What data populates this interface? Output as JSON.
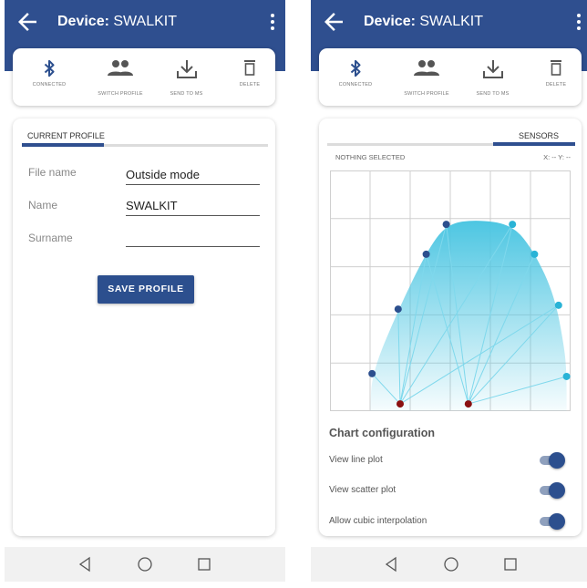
{
  "device": {
    "title_prefix": "Device:",
    "title_name": "SWALKIT"
  },
  "toolbar": {
    "connected_label": "CONNECTED",
    "switch_profile_label": "SWITCH PROFILE",
    "send_label": "SEND TO MS",
    "delete_label": "DELETE"
  },
  "profile": {
    "tab_label": "CURRENT PROFILE",
    "fields": {
      "file_name": {
        "label": "File name",
        "value": "Outside mode"
      },
      "name": {
        "label": "Name",
        "value": "SWALKIT"
      },
      "surname": {
        "label": "Surname",
        "value": ""
      }
    },
    "save_label": "SAVE PROFILE"
  },
  "sensors": {
    "tab_label": "SENSORS",
    "selection": "NOTHING SELECTED",
    "coordinates": "X: -- Y: --"
  },
  "chart_data": {
    "type": "scatter",
    "xlim": [
      0,
      6
    ],
    "ylim": [
      0,
      5
    ],
    "grid": true,
    "points": [
      {
        "x": 1.75,
        "y": 0.15,
        "color": "#8a1010"
      },
      {
        "x": 3.45,
        "y": 0.15,
        "color": "#8a1010"
      },
      {
        "x": 1.05,
        "y": 0.78,
        "color": "#2c4f8e"
      },
      {
        "x": 1.7,
        "y": 2.12,
        "color": "#2c4f8e"
      },
      {
        "x": 2.4,
        "y": 3.26,
        "color": "#2c4f8e"
      },
      {
        "x": 2.9,
        "y": 3.88,
        "color": "#2c4f8e"
      },
      {
        "x": 4.55,
        "y": 3.88,
        "color": "#29b3d6"
      },
      {
        "x": 5.1,
        "y": 3.26,
        "color": "#29b3d6"
      },
      {
        "x": 5.7,
        "y": 2.2,
        "color": "#29b3d6"
      },
      {
        "x": 5.9,
        "y": 0.72,
        "color": "#29b3d6"
      }
    ],
    "outline": [
      [
        1.0,
        0.0
      ],
      [
        1.05,
        0.8
      ],
      [
        1.7,
        2.1
      ],
      [
        2.4,
        3.3
      ],
      [
        2.9,
        3.88
      ],
      [
        3.6,
        3.98
      ],
      [
        4.55,
        3.88
      ],
      [
        5.1,
        3.3
      ],
      [
        5.6,
        2.4
      ],
      [
        5.85,
        1.3
      ],
      [
        5.9,
        0.75
      ],
      [
        5.9,
        0.0
      ]
    ],
    "links": [
      [
        0,
        2
      ],
      [
        0,
        3
      ],
      [
        0,
        4
      ],
      [
        0,
        5
      ],
      [
        0,
        6
      ],
      [
        1,
        4
      ],
      [
        1,
        5
      ],
      [
        1,
        6
      ],
      [
        1,
        7
      ],
      [
        1,
        8
      ],
      [
        1,
        9
      ],
      [
        0,
        8
      ]
    ],
    "fill_color": "#4dc6e2",
    "link_color": "#7fd8ec",
    "grid_color": "#cfcfcf"
  },
  "config": {
    "title": "Chart configuration",
    "items": [
      {
        "label": "View line plot",
        "enabled": true
      },
      {
        "label": "View scatter plot",
        "enabled": true
      },
      {
        "label": "Allow cubic interpolation",
        "enabled": true
      }
    ]
  },
  "icons": {
    "back": "arrow-left-icon",
    "menu": "more-vertical-icon",
    "bluetooth": "bluetooth-icon",
    "people": "people-icon",
    "download": "download-icon",
    "trash": "trash-icon",
    "nav_back": "triangle-back-icon",
    "nav_home": "circle-home-icon",
    "nav_recents": "square-recents-icon"
  },
  "colors": {
    "primary": "#2f4f8f",
    "accent": "#29b3d6"
  }
}
